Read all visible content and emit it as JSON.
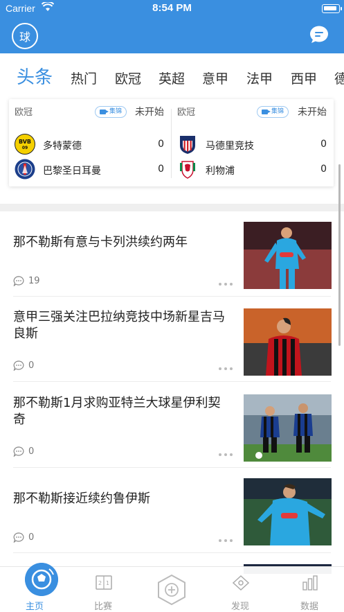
{
  "status_bar": {
    "carrier": "Carrier",
    "time": "8:54 PM"
  },
  "header": {
    "logo_text": "球"
  },
  "tabs": [
    {
      "label": "头条",
      "active": true
    },
    {
      "label": "热门"
    },
    {
      "label": "欧冠"
    },
    {
      "label": "英超"
    },
    {
      "label": "意甲"
    },
    {
      "label": "法甲"
    },
    {
      "label": "西甲"
    },
    {
      "label": "德"
    }
  ],
  "matches": [
    {
      "league": "欧冠",
      "tag": "集锦",
      "state": "未开始",
      "home": {
        "name": "多特蒙德",
        "score": "0",
        "crest": "bvb-crest-icon"
      },
      "away": {
        "name": "巴黎圣日耳曼",
        "score": "0",
        "crest": "psg-crest-icon"
      }
    },
    {
      "league": "欧冠",
      "tag": "集锦",
      "state": "未开始",
      "home": {
        "name": "马德里竞技",
        "score": "0",
        "crest": "atletico-crest-icon"
      },
      "away": {
        "name": "利物浦",
        "score": "0",
        "crest": "liverpool-crest-icon"
      }
    }
  ],
  "news": [
    {
      "title": "那不勒斯有意与卡列洪续约两年",
      "comments": "19"
    },
    {
      "title": "意甲三强关注巴拉纳竞技中场新星吉马良斯",
      "comments": "0"
    },
    {
      "title": "那不勒斯1月求购亚特兰大球星伊利契奇",
      "comments": "0"
    },
    {
      "title": "那不勒斯接近续约鲁伊斯",
      "comments": "0"
    }
  ],
  "bottom_nav": [
    {
      "label": "主页",
      "icon": "soccer-ball-icon",
      "active": true
    },
    {
      "label": "比赛",
      "icon": "scoreboard-icon"
    },
    {
      "label": "",
      "icon": "add-circle-icon"
    },
    {
      "label": "发现",
      "icon": "discover-icon"
    },
    {
      "label": "数据",
      "icon": "bar-chart-icon"
    }
  ],
  "colors": {
    "accent": "#3a8fe0"
  }
}
